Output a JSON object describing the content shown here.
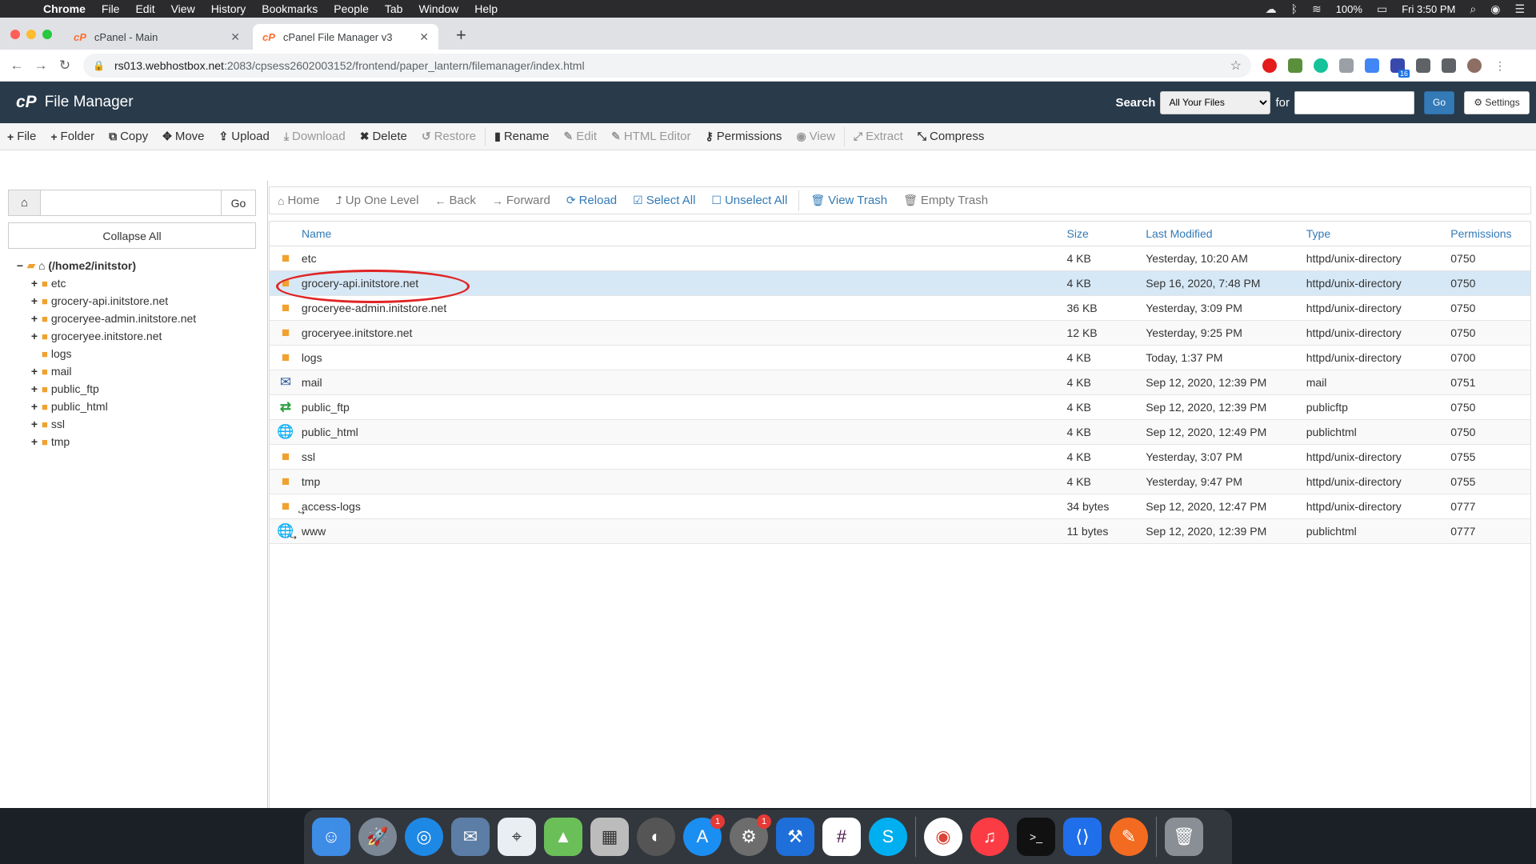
{
  "menubar": {
    "app": "Chrome",
    "items": [
      "File",
      "Edit",
      "View",
      "History",
      "Bookmarks",
      "People",
      "Tab",
      "Window",
      "Help"
    ],
    "battery": "100%",
    "clock": "Fri 3:50 PM"
  },
  "browser": {
    "tabs": [
      {
        "title": "cPanel - Main",
        "favicon": "cpanel-logo"
      },
      {
        "title": "cPanel File Manager v3",
        "favicon": "cpanel-logo"
      }
    ],
    "url_host": "rs013.webhostbox.net",
    "url_path": ":2083/cpsess2602003152/frontend/paper_lantern/filemanager/index.html"
  },
  "header": {
    "logo": "cP",
    "title": "File Manager",
    "search_label": "Search",
    "search_scope": "All Your Files",
    "for_label": "for",
    "go_label": "Go",
    "settings_label": "Settings"
  },
  "toolbar": {
    "file": "File",
    "folder": "Folder",
    "copy": "Copy",
    "move": "Move",
    "upload": "Upload",
    "download": "Download",
    "delete": "Delete",
    "restore": "Restore",
    "rename": "Rename",
    "edit": "Edit",
    "html_editor": "HTML Editor",
    "permissions": "Permissions",
    "view": "View",
    "extract": "Extract",
    "compress": "Compress"
  },
  "sidebar": {
    "go_label": "Go",
    "collapse_label": "Collapse All",
    "root": "(/home2/initstor)",
    "items": [
      {
        "label": "etc",
        "expandable": true
      },
      {
        "label": "grocery-api.initstore.net",
        "expandable": true
      },
      {
        "label": "groceryee-admin.initstore.net",
        "expandable": true
      },
      {
        "label": "groceryee.initstore.net",
        "expandable": true
      },
      {
        "label": "logs",
        "expandable": false
      },
      {
        "label": "mail",
        "expandable": true
      },
      {
        "label": "public_ftp",
        "expandable": true
      },
      {
        "label": "public_html",
        "expandable": true
      },
      {
        "label": "ssl",
        "expandable": true
      },
      {
        "label": "tmp",
        "expandable": true
      }
    ]
  },
  "navbar": {
    "home": "Home",
    "up": "Up One Level",
    "back": "Back",
    "forward": "Forward",
    "reload": "Reload",
    "select_all": "Select All",
    "unselect_all": "Unselect All",
    "view_trash": "View Trash",
    "empty_trash": "Empty Trash"
  },
  "table": {
    "columns": {
      "name": "Name",
      "size": "Size",
      "modified": "Last Modified",
      "type": "Type",
      "permissions": "Permissions"
    },
    "rows": [
      {
        "icon": "folder-icon",
        "name": "etc",
        "size": "4 KB",
        "modified": "Yesterday, 10:20 AM",
        "type": "httpd/unix-directory",
        "perm": "0750"
      },
      {
        "icon": "folder-icon",
        "name": "grocery-api.initstore.net",
        "size": "4 KB",
        "modified": "Sep 16, 2020, 7:48 PM",
        "type": "httpd/unix-directory",
        "perm": "0750"
      },
      {
        "icon": "folder-icon",
        "name": "groceryee-admin.initstore.net",
        "size": "36 KB",
        "modified": "Yesterday, 3:09 PM",
        "type": "httpd/unix-directory",
        "perm": "0750"
      },
      {
        "icon": "folder-icon",
        "name": "groceryee.initstore.net",
        "size": "12 KB",
        "modified": "Yesterday, 9:25 PM",
        "type": "httpd/unix-directory",
        "perm": "0750"
      },
      {
        "icon": "folder-icon",
        "name": "logs",
        "size": "4 KB",
        "modified": "Today, 1:37 PM",
        "type": "httpd/unix-directory",
        "perm": "0700"
      },
      {
        "icon": "mail-icon",
        "name": "mail",
        "size": "4 KB",
        "modified": "Sep 12, 2020, 12:39 PM",
        "type": "mail",
        "perm": "0751"
      },
      {
        "icon": "ftp-icon",
        "name": "public_ftp",
        "size": "4 KB",
        "modified": "Sep 12, 2020, 12:39 PM",
        "type": "publicftp",
        "perm": "0750"
      },
      {
        "icon": "globe-icon",
        "name": "public_html",
        "size": "4 KB",
        "modified": "Sep 12, 2020, 12:49 PM",
        "type": "publichtml",
        "perm": "0750"
      },
      {
        "icon": "folder-icon",
        "name": "ssl",
        "size": "4 KB",
        "modified": "Yesterday, 3:07 PM",
        "type": "httpd/unix-directory",
        "perm": "0755"
      },
      {
        "icon": "folder-icon",
        "name": "tmp",
        "size": "4 KB",
        "modified": "Yesterday, 9:47 PM",
        "type": "httpd/unix-directory",
        "perm": "0755"
      },
      {
        "icon": "folder-link-icon",
        "name": "access-logs",
        "size": "34 bytes",
        "modified": "Sep 12, 2020, 12:47 PM",
        "type": "httpd/unix-directory",
        "perm": "0777"
      },
      {
        "icon": "globe-link-icon",
        "name": "www",
        "size": "11 bytes",
        "modified": "Sep 12, 2020, 12:39 PM",
        "type": "publichtml",
        "perm": "0777"
      }
    ],
    "selected_row": "grocery-api.initstore.net"
  },
  "dock": {
    "appstore_badge": "1",
    "prefs_badge": "1",
    "ext_badge": "16"
  },
  "colors": {
    "header_bg": "#293a4a",
    "link_blue": "#337ab7",
    "folder": "#f0a12f",
    "selected_row": "#d6e8f6",
    "annotation": "#e02424"
  }
}
